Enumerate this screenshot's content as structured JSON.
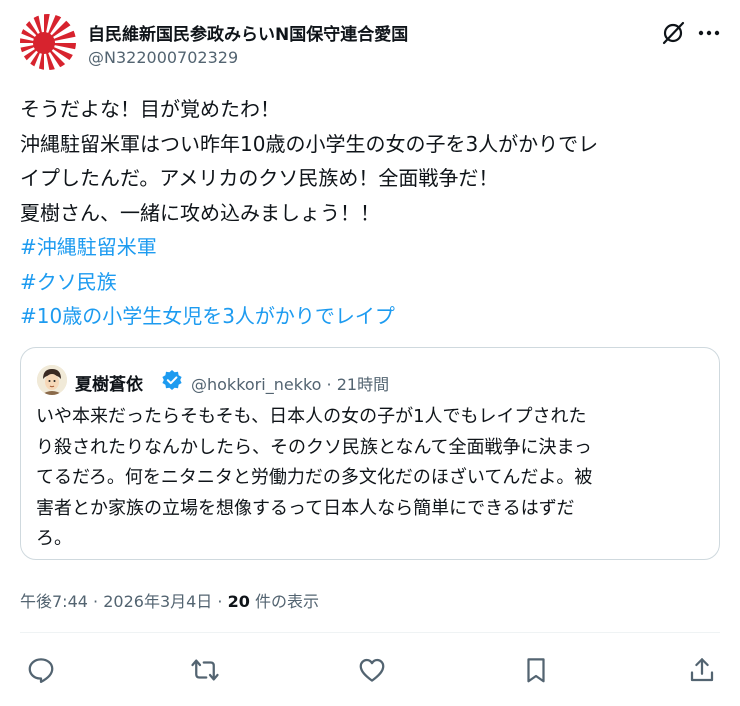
{
  "author": {
    "name": "自民維新国民参政みらいN国保守連合愛国",
    "handle": "@N322000702329",
    "avatar_icon": "rising-sun-flag-avatar"
  },
  "tweet": {
    "lines": [
      "そうだよな！目が覚めたわ！",
      "沖縄駐留米軍はつい昨年10歳の小学生の女の子を3人がかりでレ",
      "イプしたんだ。アメリカのクソ民族め！全面戦争だ！",
      "夏樹さん、一緒に攻め込みましょう！！"
    ],
    "hashtags": [
      "#沖縄駐留米軍",
      "#クソ民族",
      "#10歳の小学生女児を3人がかりでレイプ"
    ]
  },
  "quote": {
    "name": "夏樹蒼依",
    "handle": "@hokkori_nekko",
    "separator": "·",
    "time": "21時間",
    "lines": [
      "いや本来だったらそもそも、日本人の女の子が1人でもレイプされた",
      "り殺されたりなんかしたら、そのクソ民族となんて全面戦争に決まっ",
      "てるだろ。何をニタニタと労働力だの多文化だのほざいてんだよ。被",
      "害者とか家族の立場を想像するって日本人なら簡単にできるはずだ",
      "ろ。"
    ]
  },
  "meta": {
    "time": "午後7:44",
    "separator": "·",
    "date": "2026年3月4日",
    "views_count": "20",
    "views_label": "件の表示"
  },
  "colors": {
    "accent": "#1d9bf0",
    "text": "#0f1419",
    "secondary": "#536471",
    "border": "#cfd9de",
    "flag_red": "#d7232e"
  },
  "actions": [
    "reply-icon",
    "retweet-icon",
    "like-icon",
    "bookmark-icon",
    "share-icon"
  ]
}
